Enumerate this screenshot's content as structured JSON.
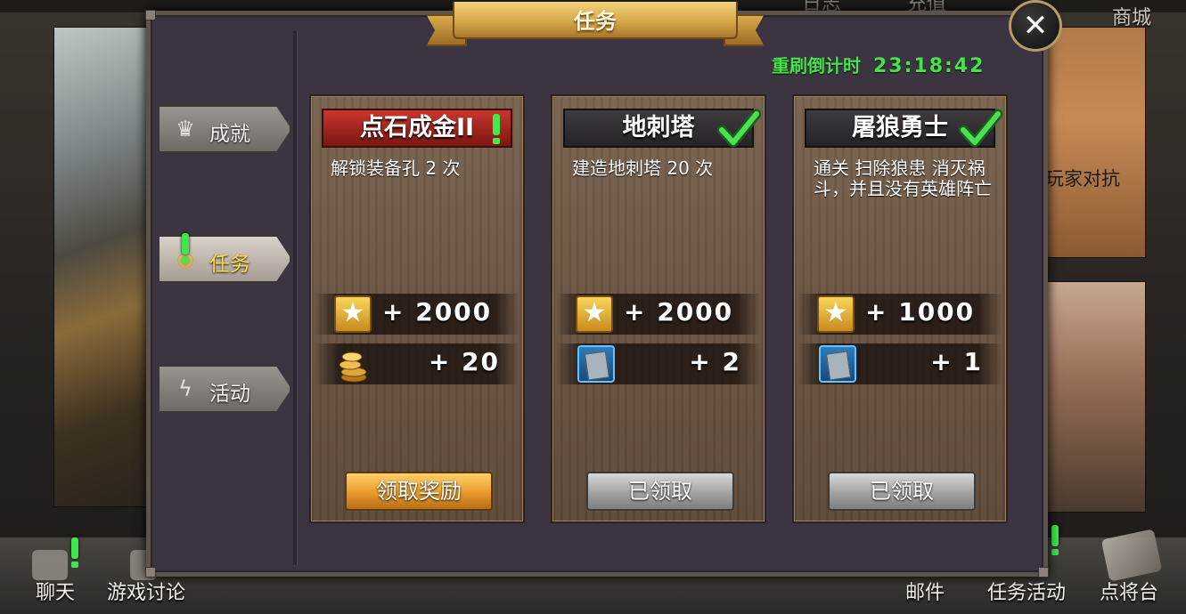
{
  "top_nav": {
    "shop_label": "商城",
    "partial_1": "日志",
    "partial_2": "充值"
  },
  "background_panels": {
    "pvp_label": "玩家对抗"
  },
  "dialog": {
    "title": "任务",
    "timer_label": "重刷倒计时",
    "timer_value": "23:18:42"
  },
  "sidebar": {
    "tabs": [
      {
        "label": "成就",
        "icon": "crown-icon",
        "active": false
      },
      {
        "label": "任务",
        "icon": "task-eye-icon",
        "active": true
      },
      {
        "label": "活动",
        "icon": "lightning-icon",
        "active": false
      }
    ]
  },
  "cards": [
    {
      "title": "点石成金II",
      "title_style": "red",
      "status": "exclamation",
      "description": "解锁装备孔 2 次",
      "rewards": [
        {
          "icon": "star-icon",
          "amount": "+ 2000"
        },
        {
          "icon": "gold-coins-icon",
          "amount": "+ 20"
        }
      ],
      "button_label": "领取奖励",
      "button_style": "gold"
    },
    {
      "title": "地刺塔",
      "title_style": "dark",
      "status": "check",
      "description": "建造地刺塔 20 次",
      "rewards": [
        {
          "icon": "star-icon",
          "amount": "+ 2000"
        },
        {
          "icon": "tiger-card-icon",
          "amount": "+ 2"
        }
      ],
      "button_label": "已领取",
      "button_style": "grey"
    },
    {
      "title": "屠狼勇士",
      "title_style": "dark",
      "status": "check",
      "description": "通关 扫除狼患 消灭祸斗，并且没有英雄阵亡",
      "rewards": [
        {
          "icon": "star-icon",
          "amount": "+ 1000"
        },
        {
          "icon": "tiger-card-icon",
          "amount": "+ 1"
        }
      ],
      "button_label": "已领取",
      "button_style": "grey"
    }
  ],
  "bottom_bar": {
    "chat": "聊天",
    "discussion": "游戏讨论",
    "mail": "邮件",
    "task_activity": "任务活动",
    "general_stage": "点将台"
  },
  "colors": {
    "accent_green": "#45e34b",
    "gold_button": "#e89a2a",
    "dialog_bg": "#3c3541"
  }
}
